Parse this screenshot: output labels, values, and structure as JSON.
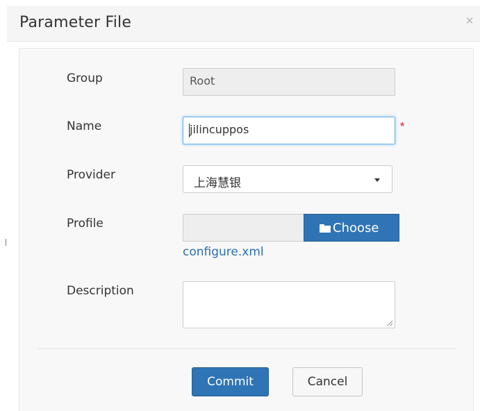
{
  "dialog": {
    "title": "Parameter File",
    "close_icon": "close-icon"
  },
  "form": {
    "group": {
      "label": "Group",
      "value": "Root"
    },
    "name": {
      "label": "Name",
      "value": "jilincuppos",
      "required_mark": "*"
    },
    "provider": {
      "label": "Provider",
      "selected": "上海慧银",
      "icon": "caret-down-icon"
    },
    "profile": {
      "label": "Profile",
      "file_value": "",
      "choose_label": "Choose",
      "choose_icon": "folder-open-icon",
      "file_link": "configure.xml"
    },
    "description": {
      "label": "Description",
      "value": ""
    }
  },
  "actions": {
    "commit_label": "Commit",
    "cancel_label": "Cancel"
  },
  "colors": {
    "primary": "#2f74b5",
    "required": "#d9534f",
    "link": "#2a6fb0"
  }
}
